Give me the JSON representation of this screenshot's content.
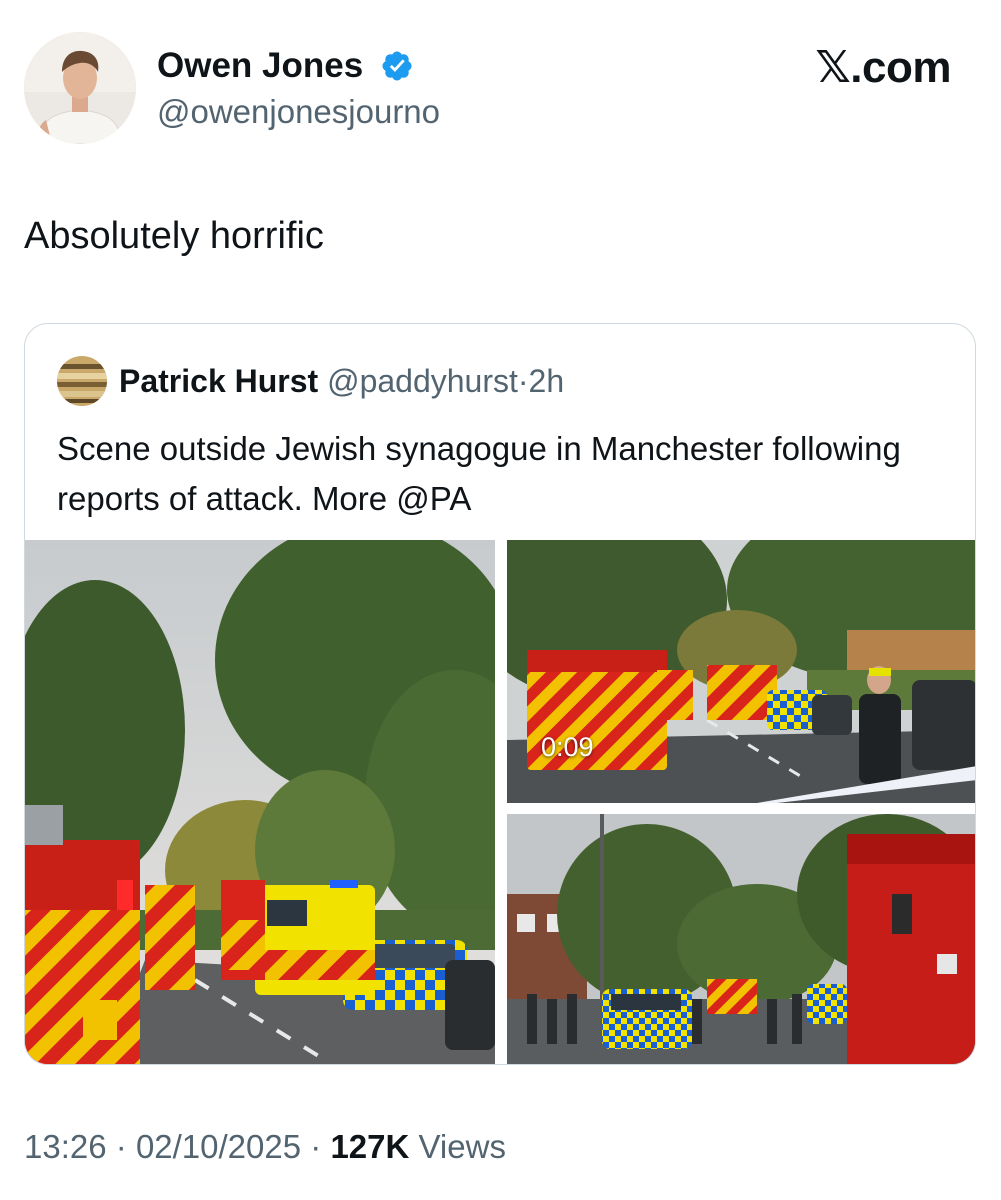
{
  "author": {
    "display_name": "Owen Jones",
    "handle": "@owenjonesjourno",
    "verified": true,
    "verified_icon": "verified-badge-icon",
    "avatar_icon": "profile-photo-icon"
  },
  "brand": {
    "label": "𝕏.com"
  },
  "tweet": {
    "text": "Absolutely horrific"
  },
  "quote": {
    "display_name": "Patrick Hurst",
    "handle": "@paddyhurst",
    "separator": "·",
    "time": "2h",
    "text": "Scene outside Jewish synagogue in Manchester following reports of attack. More @PA",
    "media": [
      {
        "type": "photo",
        "icon": "fire-engines-street-photo"
      },
      {
        "type": "video",
        "duration": "0:09",
        "icon": "fire-engine-video-thumbnail"
      },
      {
        "type": "photo",
        "icon": "cordoned-street-photo"
      }
    ]
  },
  "footer": {
    "time": "13:26",
    "separator": "·",
    "date": "02/10/2025",
    "views_count": "127K",
    "views_label": "Views"
  },
  "colors": {
    "text_primary": "#0f1419",
    "text_secondary": "#536471",
    "border": "#cfd9de",
    "verified_blue": "#1d9bf0"
  }
}
